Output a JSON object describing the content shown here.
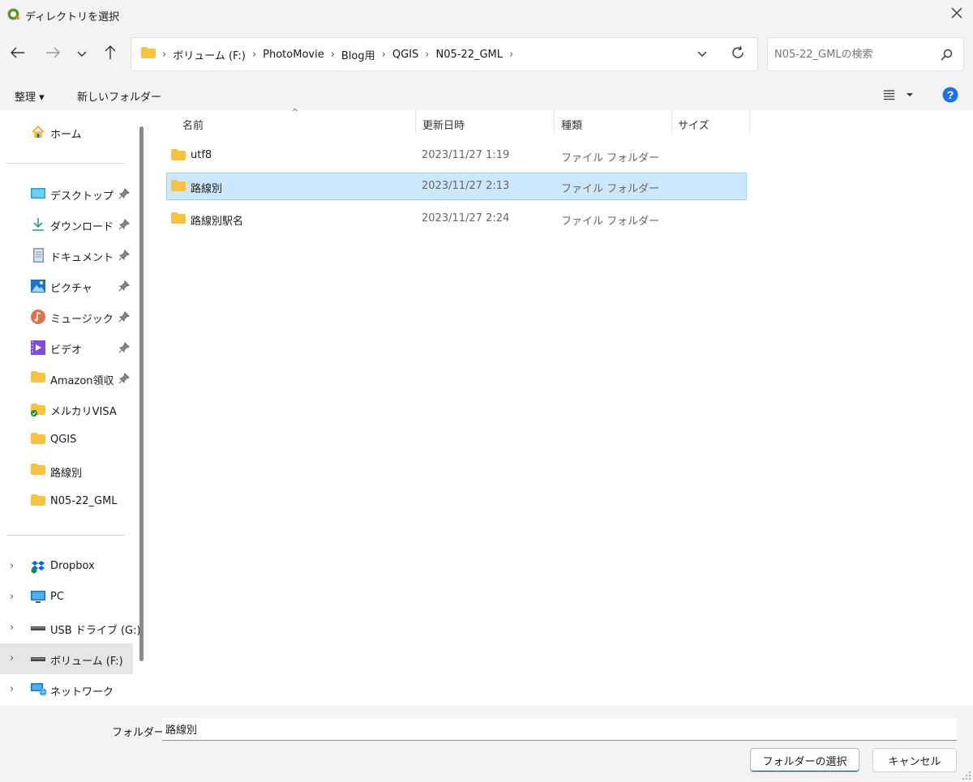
{
  "window": {
    "title": "ディレクトリを選択",
    "app_icon": "qgis-icon",
    "close_icon": "close-icon"
  },
  "nav": {
    "back_icon": "arrow-left-icon",
    "forward_icon": "arrow-right-icon",
    "recent_icon": "chevron-down-icon",
    "up_icon": "arrow-up-icon"
  },
  "address": {
    "folder_icon": "folder-icon",
    "crumbs": [
      "ボリューム (F:)",
      "PhotoMovie",
      "Blog用",
      "QGIS",
      "N05-22_GML"
    ],
    "dropdown_icon": "chevron-down-icon",
    "refresh_icon": "refresh-icon"
  },
  "search": {
    "placeholder": "N05-22_GMLの検索",
    "icon": "search-icon"
  },
  "toolbar": {
    "organize_label": "整理 ▾",
    "new_folder_label": "新しいフォルダー",
    "view_icon": "list-view-icon",
    "help_icon": "help-icon"
  },
  "sidebar": {
    "home": "ホーム",
    "quick": [
      {
        "label": "デスクトップ",
        "icon": "desktop-icon",
        "pinned": true
      },
      {
        "label": "ダウンロード",
        "icon": "download-icon",
        "pinned": true
      },
      {
        "label": "ドキュメント",
        "icon": "document-icon",
        "pinned": true
      },
      {
        "label": "ピクチャ",
        "icon": "pictures-icon",
        "pinned": true
      },
      {
        "label": "ミュージック",
        "icon": "music-icon",
        "pinned": true
      },
      {
        "label": "ビデオ",
        "icon": "video-icon",
        "pinned": true
      },
      {
        "label": "Amazon領収",
        "icon": "folder-icon",
        "pinned": true
      },
      {
        "label": "メルカリVISA",
        "icon": "folder-synced-icon",
        "pinned": false
      },
      {
        "label": "QGIS",
        "icon": "folder-icon",
        "pinned": false
      },
      {
        "label": "路線別",
        "icon": "folder-icon",
        "pinned": false
      },
      {
        "label": "N05-22_GML",
        "icon": "folder-icon",
        "pinned": false
      }
    ],
    "locations": [
      {
        "label": "Dropbox",
        "icon": "dropbox-icon"
      },
      {
        "label": "PC",
        "icon": "computer-icon"
      },
      {
        "label": "USB ドライブ (G:)",
        "icon": "drive-icon"
      },
      {
        "label": "ボリューム (F:)",
        "icon": "drive-icon",
        "selected": true
      },
      {
        "label": "ネットワーク",
        "icon": "network-icon"
      }
    ]
  },
  "filelist": {
    "columns": [
      "名前",
      "更新日時",
      "種類",
      "サイズ"
    ],
    "rows": [
      {
        "name": "utf8",
        "date": "2023/11/27 1:19",
        "type": "ファイル フォルダー",
        "selected": false
      },
      {
        "name": "路線別",
        "date": "2023/11/27 2:13",
        "type": "ファイル フォルダー",
        "selected": true
      },
      {
        "name": "路線別駅名",
        "date": "2023/11/27 2:24",
        "type": "ファイル フォルダー",
        "selected": false
      }
    ]
  },
  "footer": {
    "folder_label": "フォルダー:",
    "folder_value": "路線別",
    "select_button": "フォルダーの選択",
    "cancel_button": "キャンセル"
  },
  "colors": {
    "accent": "#0067c0",
    "selection_bg": "#cce8ff",
    "selection_border": "#99d1ff",
    "folder": "#f5c242",
    "help": "#1a73e8"
  }
}
